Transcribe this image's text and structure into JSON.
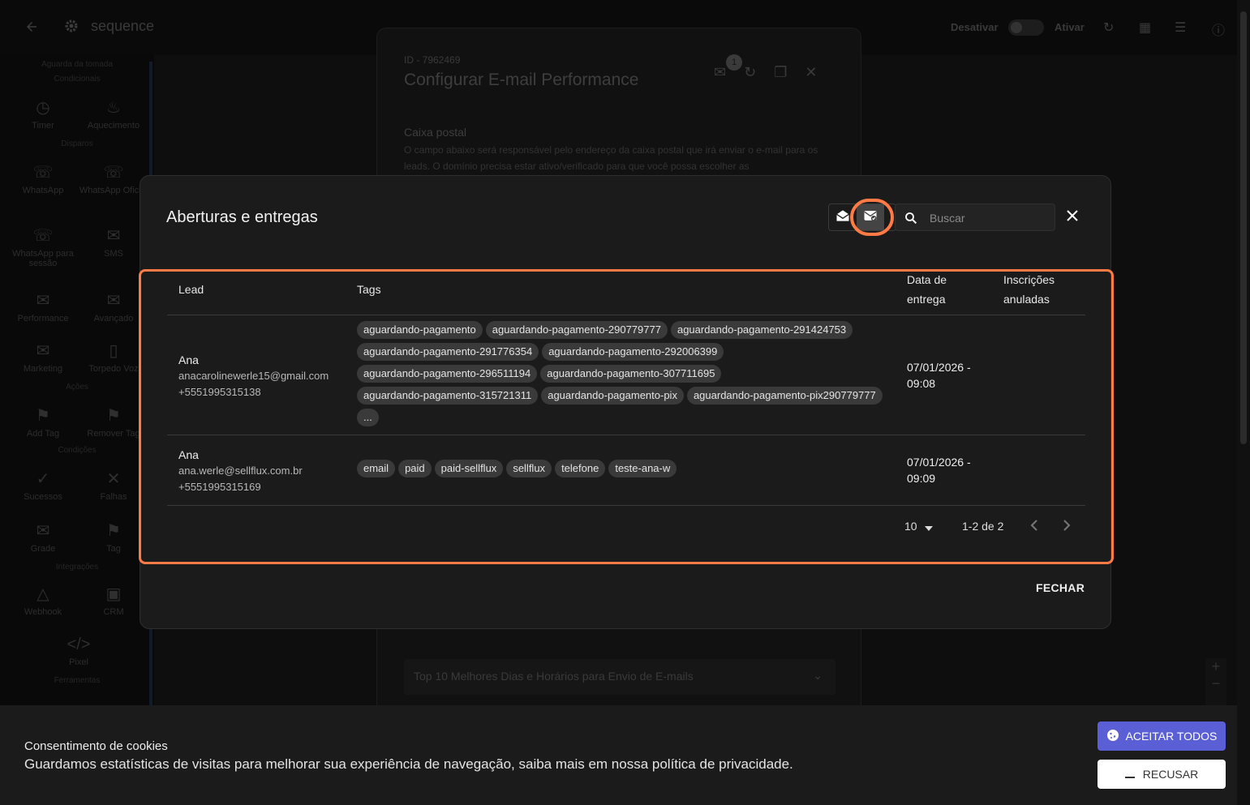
{
  "topbar": {
    "title": "sequence",
    "desativar": "Desativar",
    "ativar": "Ativar"
  },
  "sidebar": {
    "sections": [
      "Aguarda da tomada",
      "Condicionais",
      "Disparos",
      "Ações",
      "Condições",
      "Integrações",
      "Ferramentas"
    ],
    "items": [
      {
        "label": "Timer",
        "icon": "alarm-icon"
      },
      {
        "label": "Aquecimento",
        "icon": "fire-icon"
      },
      {
        "label": "WhatsApp",
        "icon": "whatsapp-icon"
      },
      {
        "label": "WhatsApp Oficial",
        "icon": "whatsapp-icon"
      },
      {
        "label": "WhatsApp para sessão",
        "icon": "whatsapp-icon"
      },
      {
        "label": "SMS",
        "icon": "sms-icon"
      },
      {
        "label": "Performance",
        "icon": "mail-icon"
      },
      {
        "label": "Avançado",
        "icon": "mail-icon"
      },
      {
        "label": "Marketing",
        "icon": "mail-icon"
      },
      {
        "label": "Torpedo Voz",
        "icon": "phone-icon"
      },
      {
        "label": "Add Tag",
        "icon": "tag-icon"
      },
      {
        "label": "Remover Tag",
        "icon": "tag-icon"
      },
      {
        "label": "Sucessos",
        "icon": "check-icon"
      },
      {
        "label": "Falhas",
        "icon": "x-icon"
      },
      {
        "label": "Grade",
        "icon": "mail-icon"
      },
      {
        "label": "Tag",
        "icon": "tag-icon"
      },
      {
        "label": "Webhook",
        "icon": "webhook-icon"
      },
      {
        "label": "CRM",
        "icon": "crm-icon"
      },
      {
        "label": "Pixel",
        "icon": "code-icon"
      }
    ]
  },
  "panel": {
    "id": "ID - 7962469",
    "title": "Configurar E-mail Performance",
    "badge": "1",
    "caixa_postal": "Caixa postal",
    "caixa_desc": "O campo abaixo será responsável pelo endereço da caixa postal que irá enviar o e-mail para os leads. O domínio precisa estar ativo/verificado para que você possa escolher as",
    "accordion": "Top 10 Melhores Dias e Horários para Envio de E-mails"
  },
  "modal": {
    "title": "Aberturas e entregas",
    "search_placeholder": "Buscar",
    "columns": {
      "lead": "Lead",
      "tags": "Tags",
      "date_line1": "Data de",
      "date_line2": "entrega",
      "unsub_line1": "Inscrições",
      "unsub_line2": "anuladas"
    },
    "rows": [
      {
        "name": "Ana",
        "email": "anacarolinewerle15@gmail.com",
        "phone": "+5551995315138",
        "tags": [
          "aguardando-pagamento",
          "aguardando-pagamento-290779777",
          "aguardando-pagamento-291424753",
          "aguardando-pagamento-291776354",
          "aguardando-pagamento-292006399",
          "aguardando-pagamento-296511194",
          "aguardando-pagamento-307711695",
          "aguardando-pagamento-315721311",
          "aguardando-pagamento-pix",
          "aguardando-pagamento-pix290779777",
          "..."
        ],
        "date_line1": "07/01/2026 -",
        "date_line2": "09:08",
        "unsub": ""
      },
      {
        "name": "Ana",
        "email": "ana.werle@sellflux.com.br",
        "phone": "+5551995315169",
        "tags": [
          "email",
          "paid",
          "paid-sellflux",
          "sellflux",
          "telefone",
          "teste-ana-w"
        ],
        "date_line1": "07/01/2026 -",
        "date_line2": "09:09",
        "unsub": ""
      }
    ],
    "pagination": {
      "per_page": "10",
      "range": "1-2 de 2"
    },
    "close_label": "FECHAR"
  },
  "cookie": {
    "title": "Consentimento de cookies",
    "text": "Guardamos estatísticas de visitas para melhorar sua experiência de navegação, saiba mais em nossa política de privacidade.",
    "accept": "ACEITAR TODOS",
    "refuse": "RECUSAR"
  },
  "colors": {
    "highlight": "#ff7a45",
    "accept_button": "#5b5fd6",
    "modal_bg": "#1b1b1b"
  }
}
